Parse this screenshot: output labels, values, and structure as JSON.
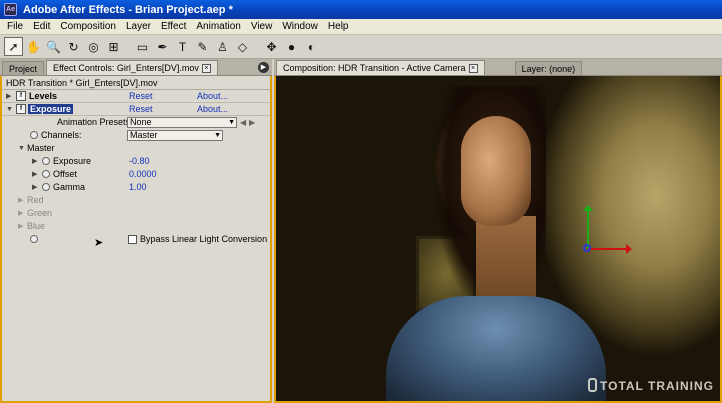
{
  "window": {
    "title": "Adobe After Effects - Brian Project.aep *"
  },
  "menubar": {
    "items": [
      "File",
      "Edit",
      "Composition",
      "Layer",
      "Effect",
      "Animation",
      "View",
      "Window",
      "Help"
    ]
  },
  "toolbar": {
    "tools": [
      "selection-tool",
      "hand-tool",
      "zoom-tool",
      "rotation-tool",
      "orbit-camera-tool",
      "pan-behind-tool",
      "rectangle-mask-tool",
      "pen-tool",
      "type-tool",
      "brush-tool",
      "clone-stamp-tool",
      "eraser-tool",
      "axis-mode",
      "world-axis",
      "view-axis"
    ],
    "active_tool": "selection-tool"
  },
  "left_panel": {
    "tabs": [
      {
        "label": "Project",
        "active": false
      },
      {
        "label": "Effect Controls: Girl_Enters[DV].mov",
        "active": true
      }
    ],
    "header": "HDR Transition * Girl_Enters[DV].mov",
    "effects": [
      {
        "name": "Levels",
        "reset": "Reset",
        "about": "About..."
      },
      {
        "name": "Exposure",
        "reset": "Reset",
        "about": "About..."
      }
    ],
    "animation_presets": {
      "label": "Animation Presets:",
      "value": "None"
    },
    "channels": {
      "label": "Channels:",
      "value": "Master"
    },
    "master": {
      "label": "Master",
      "params": [
        {
          "label": "Exposure",
          "value": "-0.80"
        },
        {
          "label": "Offset",
          "value": "0.0000"
        },
        {
          "label": "Gamma",
          "value": "1.00"
        }
      ]
    },
    "disabled_groups": [
      "Red",
      "Green",
      "Blue"
    ],
    "bypass": {
      "label": "Bypass Linear Light Conversion",
      "checked": false
    }
  },
  "right_panel": {
    "tabs": [
      {
        "label": "Composition: HDR Transition - Active Camera",
        "active": true
      },
      {
        "label": "Layer: (none)",
        "active": false
      }
    ],
    "watermark": "TOTAL TRAINING"
  },
  "colors": {
    "panel_focus_border": "#e0a000",
    "link": "#1530b8",
    "axis_x": "#d01010",
    "axis_y": "#18b018",
    "axis_z": "#2a3ad8"
  }
}
